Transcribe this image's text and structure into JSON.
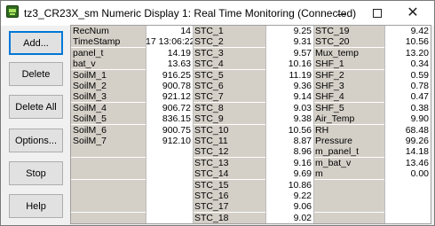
{
  "window": {
    "title": "tz3_CR23X_sm Numeric Display 1: Real Time Monitoring (Connected)"
  },
  "buttons": {
    "add": "Add...",
    "delete": "Delete",
    "delete_all": "Delete All",
    "options": "Options...",
    "stop": "Stop",
    "help": "Help"
  },
  "columns": [
    [
      {
        "name": "RecNum",
        "value": "14"
      },
      {
        "name": "TimeStamp",
        "value": "17 13:06:22"
      },
      {
        "name": "panel_t",
        "value": "14.19"
      },
      {
        "name": "bat_v",
        "value": "13.63"
      },
      {
        "name": "SoilM_1",
        "value": "916.25"
      },
      {
        "name": "SoilM_2",
        "value": "900.78"
      },
      {
        "name": "SoilM_3",
        "value": "921.12"
      },
      {
        "name": "SoilM_4",
        "value": "906.72"
      },
      {
        "name": "SoilM_5",
        "value": "836.15"
      },
      {
        "name": "SoilM_6",
        "value": "900.75"
      },
      {
        "name": "SoilM_7",
        "value": "912.10"
      },
      {
        "name": "",
        "value": ""
      },
      {
        "name": "",
        "value": ""
      },
      {
        "name": "",
        "value": ""
      },
      {
        "name": "",
        "value": ""
      },
      {
        "name": "",
        "value": ""
      },
      {
        "name": "",
        "value": ""
      },
      {
        "name": "",
        "value": ""
      }
    ],
    [
      {
        "name": "STC_1",
        "value": "9.25"
      },
      {
        "name": "STC_2",
        "value": "9.31"
      },
      {
        "name": "STC_3",
        "value": "9.57"
      },
      {
        "name": "STC_4",
        "value": "10.16"
      },
      {
        "name": "STC_5",
        "value": "11.19"
      },
      {
        "name": "STC_6",
        "value": "9.36"
      },
      {
        "name": "STC_7",
        "value": "9.14"
      },
      {
        "name": "STC_8",
        "value": "9.03"
      },
      {
        "name": "STC_9",
        "value": "9.38"
      },
      {
        "name": "STC_10",
        "value": "10.56"
      },
      {
        "name": "STC_11",
        "value": "8.87"
      },
      {
        "name": "STC_12",
        "value": "8.96"
      },
      {
        "name": "STC_13",
        "value": "9.16"
      },
      {
        "name": "STC_14",
        "value": "9.69"
      },
      {
        "name": "STC_15",
        "value": "10.86"
      },
      {
        "name": "STC_16",
        "value": "9.22"
      },
      {
        "name": "STC_17",
        "value": "9.06"
      },
      {
        "name": "STC_18",
        "value": "9.02"
      }
    ],
    [
      {
        "name": "STC_19",
        "value": "9.42"
      },
      {
        "name": "STC_20",
        "value": "10.56"
      },
      {
        "name": "Mux_temp",
        "value": "13.20"
      },
      {
        "name": "SHF_1",
        "value": "0.34"
      },
      {
        "name": "SHF_2",
        "value": "0.59"
      },
      {
        "name": "SHF_3",
        "value": "0.78"
      },
      {
        "name": "SHF_4",
        "value": "0.47"
      },
      {
        "name": "SHF_5",
        "value": "0.38"
      },
      {
        "name": "Air_Temp",
        "value": "9.90"
      },
      {
        "name": "RH",
        "value": "68.48"
      },
      {
        "name": "Pressure",
        "value": "99.26"
      },
      {
        "name": "m_panel_t",
        "value": "14.18"
      },
      {
        "name": "m_bat_v",
        "value": "13.46"
      },
      {
        "name": "m",
        "value": "0.00"
      },
      {
        "name": "",
        "value": ""
      },
      {
        "name": "",
        "value": ""
      },
      {
        "name": "",
        "value": ""
      },
      {
        "name": "",
        "value": ""
      }
    ]
  ]
}
